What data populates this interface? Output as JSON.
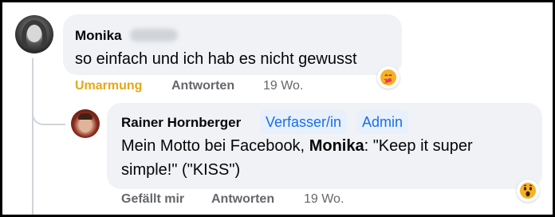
{
  "comment1": {
    "author_first": "Monika",
    "text": "so einfach und ich hab es nicht gewusst",
    "actions": {
      "hug": "Umarmung",
      "reply": "Antworten",
      "time": "19 Wo."
    },
    "reaction_icon": "hug-emoji-icon"
  },
  "comment2": {
    "author": "Rainer Hornberger",
    "badges": [
      "Verfasser/in",
      "Admin"
    ],
    "text_before": "Mein Motto bei Facebook, ",
    "text_mention": "Monika",
    "text_after": ": \"Keep it super simple!\" (\"KISS\")",
    "actions": {
      "like": "Gefällt mir",
      "reply": "Antworten",
      "time": "19 Wo."
    },
    "reaction_icon": "wow-emoji-icon"
  },
  "colors": {
    "bubble": "#f0f2f5",
    "hug_accent": "#e7a718",
    "badge_bg": "#e7f0fc",
    "badge_text": "#1a6ee8",
    "muted": "#65676b"
  }
}
